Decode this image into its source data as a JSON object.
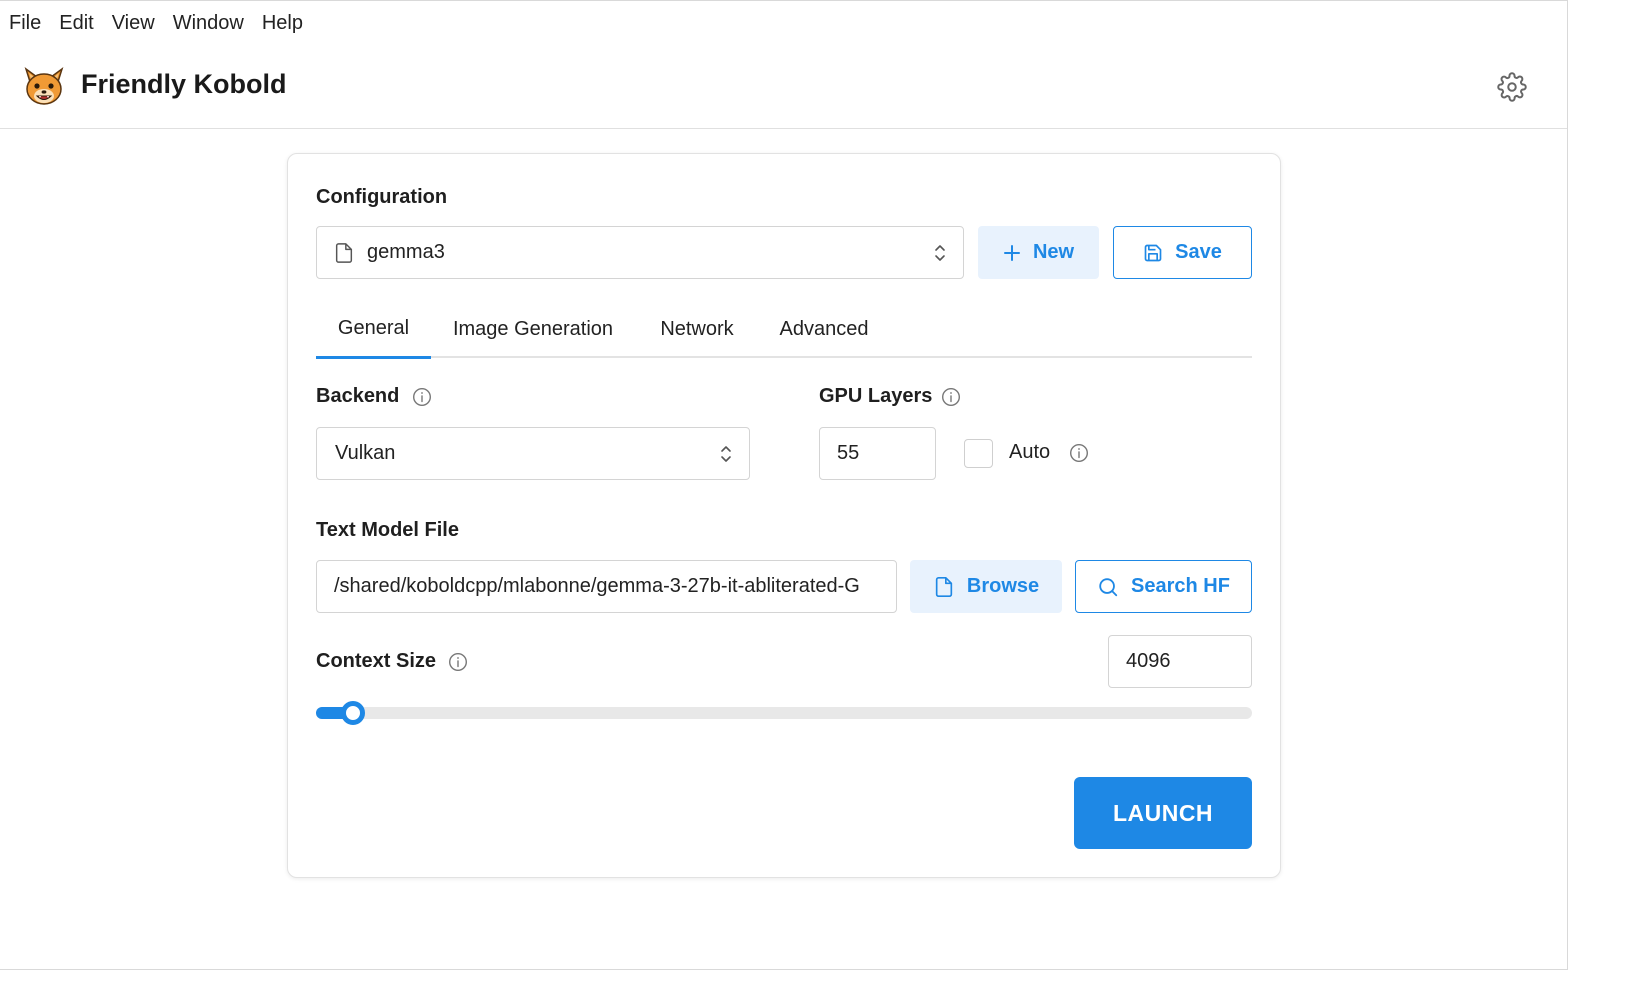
{
  "menu": [
    "File",
    "Edit",
    "View",
    "Window",
    "Help"
  ],
  "app": {
    "title": "Friendly Kobold"
  },
  "config": {
    "label": "Configuration",
    "selected": "gemma3",
    "new_label": "New",
    "save_label": "Save"
  },
  "tabs": [
    "General",
    "Image Generation",
    "Network",
    "Advanced"
  ],
  "active_tab": "General",
  "backend": {
    "label": "Backend",
    "value": "Vulkan"
  },
  "gpu_layers": {
    "label": "GPU Layers",
    "value": "55",
    "auto_label": "Auto",
    "auto_checked": false
  },
  "model_file": {
    "label": "Text Model File",
    "value": "/shared/koboldcpp/mlabonne/gemma-3-27b-it-abliterated-G",
    "browse_label": "Browse",
    "search_label": "Search HF"
  },
  "context_size": {
    "label": "Context Size",
    "value": "4096",
    "slider_fraction": 0.04
  },
  "launch_label": "LAUNCH",
  "colors": {
    "accent": "#1e88e5",
    "accent_light": "#e8f2fd"
  }
}
